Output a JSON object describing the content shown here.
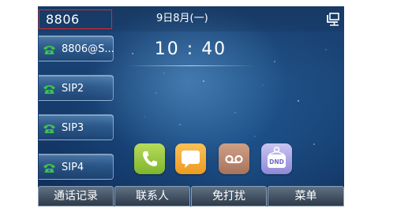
{
  "status_bar": {
    "account": "8806",
    "date": "9日8月(一)",
    "network_icon": "network-monitor-icon"
  },
  "clock": {
    "time": "10 : 40"
  },
  "line_keys": [
    {
      "label": "8806@S...",
      "icon": "phone-icon",
      "icon_color": "#3cc24a"
    },
    {
      "label": "SIP2",
      "icon": "phone-icon",
      "icon_color": "#3cc24a"
    },
    {
      "label": "SIP3",
      "icon": "phone-icon",
      "icon_color": "#3cc24a"
    },
    {
      "label": "SIP4",
      "icon": "phone-icon",
      "icon_color": "#3cc24a"
    }
  ],
  "apps": [
    {
      "name": "phone",
      "icon": "phone-app-icon"
    },
    {
      "name": "messages",
      "icon": "message-app-icon"
    },
    {
      "name": "voicemail",
      "icon": "voicemail-app-icon"
    },
    {
      "name": "dnd",
      "icon": "dnd-app-icon",
      "label": "DND"
    }
  ],
  "softkeys": [
    {
      "label": "通话记录"
    },
    {
      "label": "联系人"
    },
    {
      "label": "免打扰"
    },
    {
      "label": "菜单"
    }
  ],
  "colors": {
    "highlight_border": "#e3262c",
    "line_key_icon": "#3cc24a",
    "softkey_bg": "#465566"
  }
}
